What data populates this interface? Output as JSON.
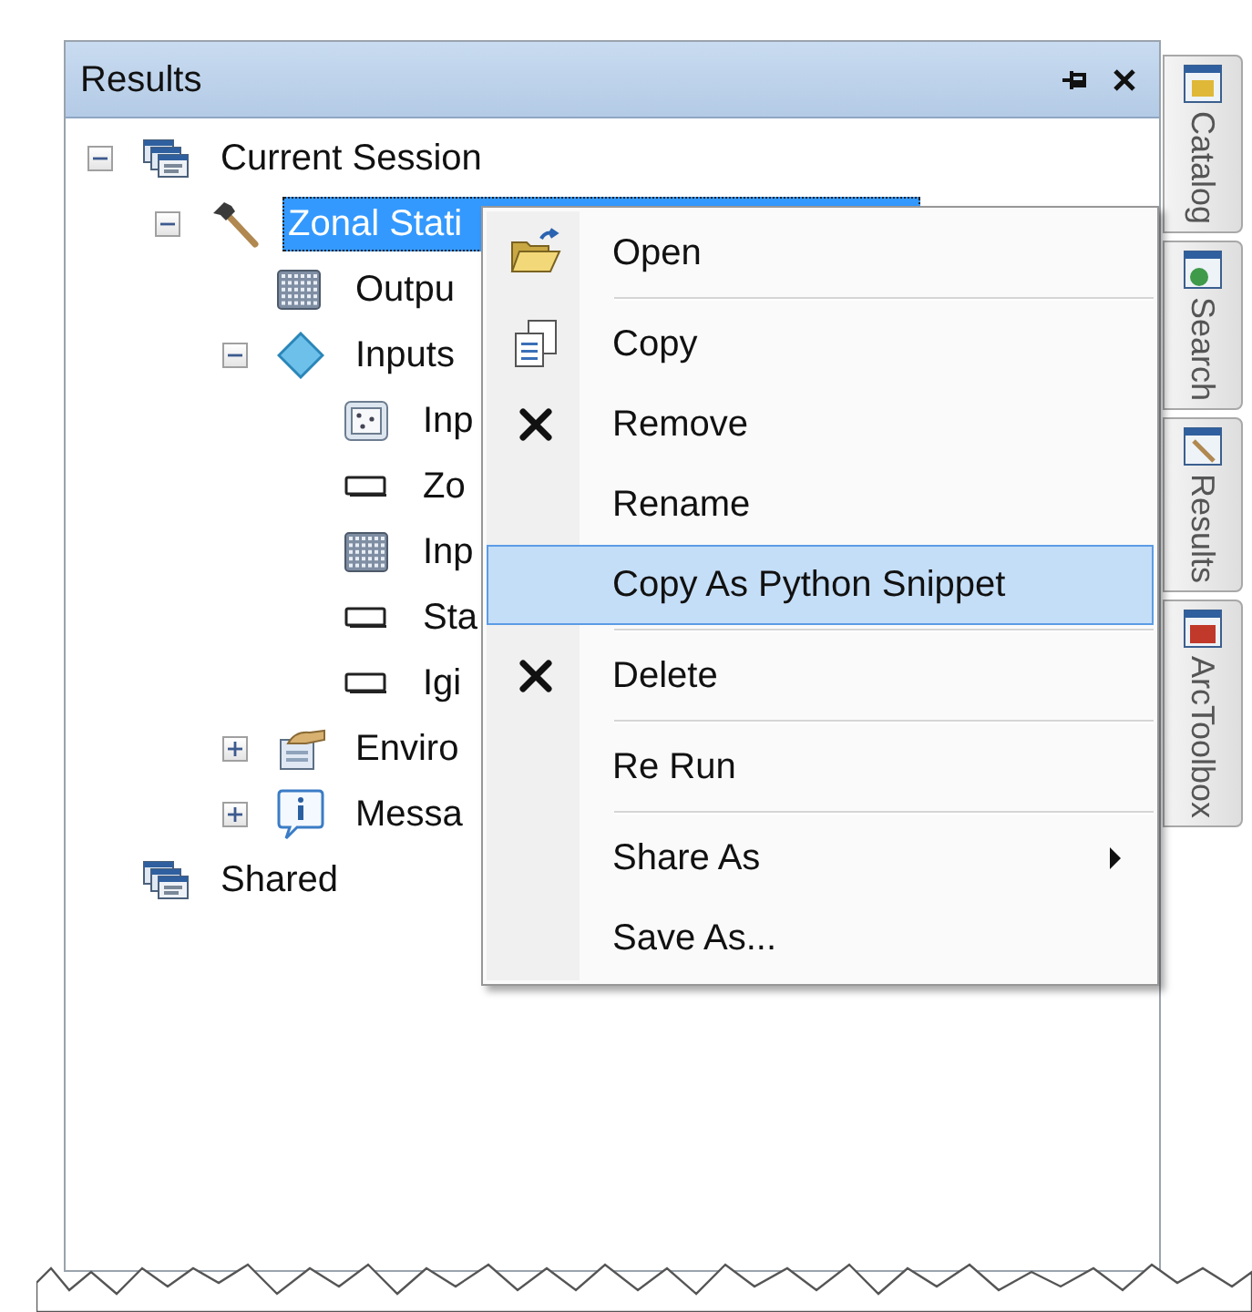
{
  "panel": {
    "title": "Results"
  },
  "tree": [
    {
      "label": "Current Session",
      "kind": "session",
      "expanded": true,
      "selected": false,
      "children": [
        {
          "label": "Zonal Stati",
          "kind": "tool",
          "expanded": true,
          "selected": true,
          "children": [
            {
              "label": "Outpu",
              "kind": "raster",
              "selected": false
            },
            {
              "label": "Inputs",
              "kind": "inputs",
              "expanded": true,
              "selected": false,
              "children": [
                {
                  "label": "Inp",
                  "kind": "feature",
                  "selected": false
                },
                {
                  "label": "Zo",
                  "kind": "field",
                  "selected": false
                },
                {
                  "label": "Inp",
                  "kind": "raster",
                  "selected": false
                },
                {
                  "label": "Sta",
                  "kind": "field",
                  "selected": false
                },
                {
                  "label": "Igi",
                  "kind": "field",
                  "selected": false
                }
              ]
            },
            {
              "label": "Enviro",
              "kind": "environments",
              "expanded": false,
              "selected": false
            },
            {
              "label": "Messa",
              "kind": "messages",
              "expanded": false,
              "selected": false
            }
          ]
        }
      ]
    },
    {
      "label": "Shared",
      "kind": "session",
      "selected": false
    }
  ],
  "context_menu": [
    {
      "kind": "open",
      "label": "Open",
      "selected": false
    },
    {
      "kind": "separator"
    },
    {
      "kind": "copy",
      "label": "Copy",
      "selected": false
    },
    {
      "kind": "remove",
      "label": "Remove",
      "selected": false
    },
    {
      "kind": "plain",
      "label": "Rename",
      "selected": false
    },
    {
      "kind": "plain",
      "label": "Copy As Python Snippet",
      "selected": true
    },
    {
      "kind": "separator"
    },
    {
      "kind": "remove",
      "label": "Delete",
      "selected": false
    },
    {
      "kind": "separator"
    },
    {
      "kind": "plain",
      "label": "Re Run",
      "selected": false
    },
    {
      "kind": "separator"
    },
    {
      "kind": "submenu",
      "label": "Share As",
      "selected": false
    },
    {
      "kind": "plain",
      "label": "Save As...",
      "selected": false
    }
  ],
  "side_tabs": [
    {
      "label": "Catalog",
      "kind": "catalog"
    },
    {
      "label": "Search",
      "kind": "search"
    },
    {
      "label": "Results",
      "kind": "results"
    },
    {
      "label": "ArcToolbox",
      "kind": "toolbox"
    }
  ]
}
